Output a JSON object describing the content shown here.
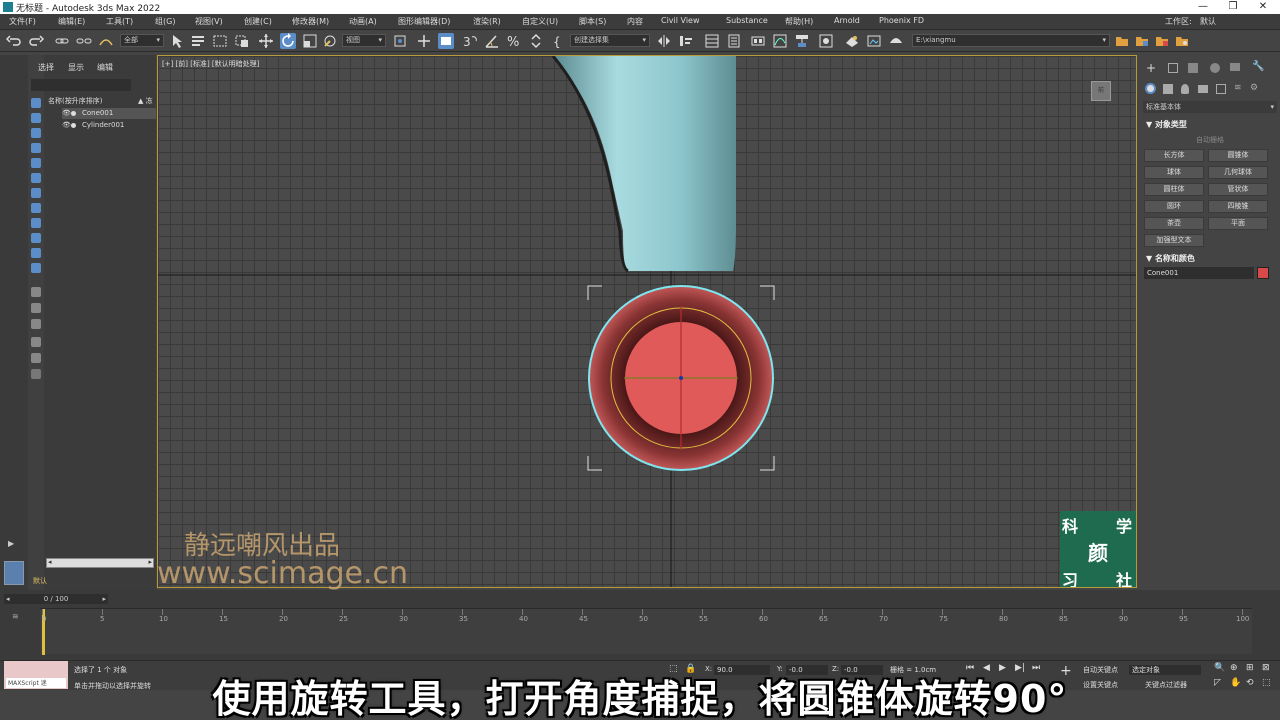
{
  "window": {
    "title": "无标题 - Autodesk 3ds Max 2022",
    "minimize": "—",
    "restore": "❒",
    "close": "✕"
  },
  "menu": {
    "items": [
      "文件(F)",
      "编辑(E)",
      "工具(T)",
      "组(G)",
      "视图(V)",
      "创建(C)",
      "修改器(M)",
      "动画(A)",
      "图形编辑器(D)",
      "渲染(R)",
      "自定义(U)",
      "脚本(S)",
      "内容",
      "Civil View",
      "Substance",
      "帮助(H)",
      "Arnold",
      "Phoenix FD"
    ],
    "workspace_label": "工作区:",
    "workspace_value": "默认"
  },
  "toolbar": {
    "filter_value": "全部",
    "view_value": "视图",
    "selection_set": "创建选择集",
    "project_path": "E:\\xiangmu"
  },
  "scene_explorer": {
    "tabs": [
      "选择",
      "显示",
      "编辑"
    ],
    "column_header": "名称(按升序排序)",
    "header_extra": "▲ 冻",
    "objects": [
      {
        "name": "Cone001",
        "selected": true
      },
      {
        "name": "Cylinder001",
        "selected": false
      }
    ],
    "layer": "默认"
  },
  "viewport": {
    "label": "[+] [前] [标准] [默认明暗处理]",
    "viewcube_label": "前"
  },
  "command_panel": {
    "category": "标准基本体",
    "section_object_type": "▼ 对象类型",
    "autogrid": "自动栅格",
    "buttons": [
      "长方体",
      "圆锥体",
      "球体",
      "几何球体",
      "圆柱体",
      "管状体",
      "圆环",
      "四棱锥",
      "茶壶",
      "平面",
      "加强型文本"
    ],
    "section_name_color": "▼ 名称和颜色",
    "object_name": "Cone001",
    "object_color": "#d84a4a"
  },
  "timeline": {
    "frame_counter": "0 / 100",
    "ticks": [
      "0",
      "5",
      "10",
      "15",
      "20",
      "25",
      "30",
      "35",
      "40",
      "45",
      "50",
      "55",
      "60",
      "65",
      "70",
      "75",
      "80",
      "85",
      "90",
      "95",
      "100"
    ]
  },
  "status": {
    "maxscript": "MAXScript 迷",
    "selected": "选择了 1 个 对象",
    "hint": "单击并拖动以选择并旋转",
    "x_label": "X:",
    "x_value": "90.0",
    "y_label": "Y:",
    "y_value": "-0.0",
    "z_label": "Z:",
    "z_value": "-0.0",
    "grid": "栅格 = 1.0cm",
    "autokey": "自动关键点",
    "selected_obj": "选定对象",
    "setkey": "设置关键点",
    "keyfilter": "关键点过滤器"
  },
  "watermark": {
    "line1": "静远嘲风出品",
    "line2": "www.scimage.cn",
    "logo_chars": [
      "科",
      "学",
      "颜",
      "习",
      "社"
    ]
  },
  "subtitle": "使用旋转工具，打开角度捕捉，将圆锥体旋转90°"
}
